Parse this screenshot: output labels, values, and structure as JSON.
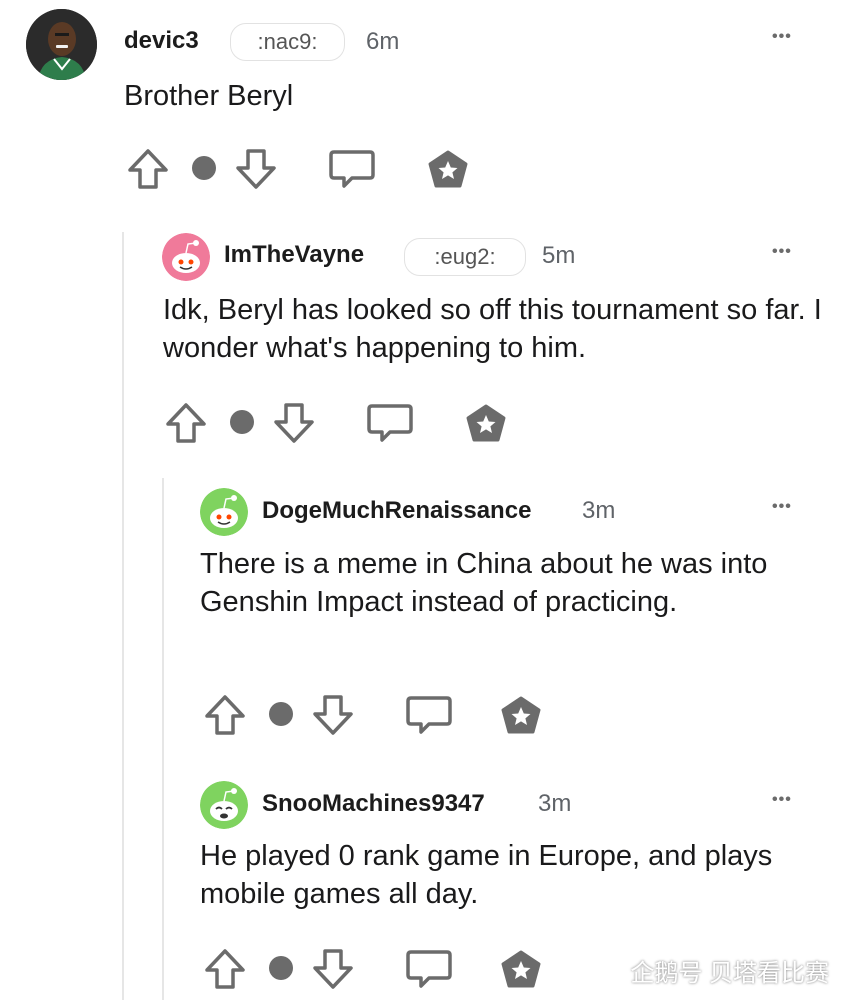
{
  "comments": [
    {
      "username": "devic3",
      "flair": ":nac9:",
      "time": "6m",
      "more": "•••",
      "body": "Brother Beryl",
      "avatar": "player-photo-avatar"
    },
    {
      "username": "ImTheVayne",
      "flair": ":eug2:",
      "time": "5m",
      "more": "•••",
      "body": "Idk, Beryl has looked so off this tournament so far. I wonder what's happening to him.",
      "avatar": "snoo-avatar-pink"
    },
    {
      "username": "DogeMuchRenaissance",
      "time": "3m",
      "more": "•••",
      "body": "There is a meme in China about he was into Genshin Impact instead of practicing.",
      "avatar": "snoo-avatar-green"
    },
    {
      "username": "SnooMachines9347",
      "time": "3m",
      "more": "•••",
      "body": "He played 0 rank game in Europe, and plays mobile games all day.",
      "avatar": "snoo-avatar-green"
    }
  ],
  "watermark": "企鹅号 贝塔看比赛",
  "colors": {
    "icon_gray": "#6b6b6b",
    "thread_line": "#e6e6e6",
    "snoo_pink": "#f07a9a",
    "snoo_green": "#7fd35f"
  }
}
